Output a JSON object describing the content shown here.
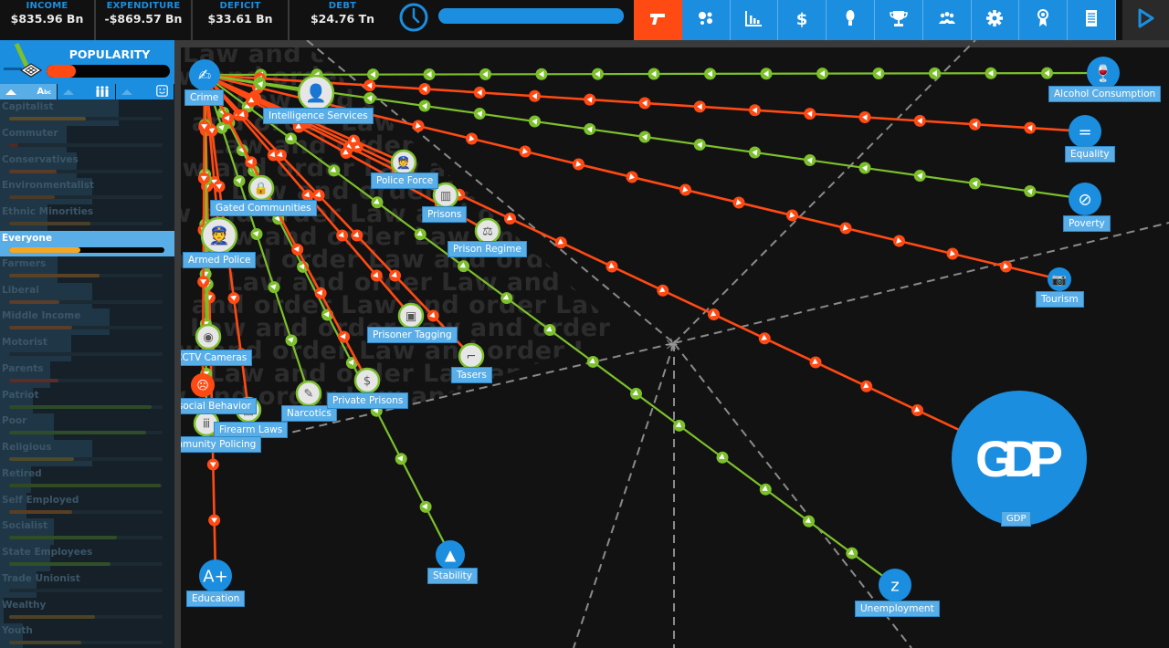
{
  "topbar": {
    "stats": [
      {
        "label": "INCOME",
        "value": "$835.96 Bn"
      },
      {
        "label": "EXPENDITURE",
        "value": "-$869.57 Bn"
      },
      {
        "label": "DEFICIT",
        "value": "$33.61 Bn"
      },
      {
        "label": "DEBT",
        "value": "$24.76 Tn"
      }
    ],
    "turn_progress": 1.0,
    "toolbar": [
      {
        "name": "law-and-order",
        "icon": "pistol-icon",
        "active": true
      },
      {
        "name": "public-services",
        "icon": "bubbles-icon",
        "active": false
      },
      {
        "name": "economy",
        "icon": "bar-chart-icon",
        "active": false
      },
      {
        "name": "tax",
        "icon": "dollar-icon",
        "active": false
      },
      {
        "name": "ideas",
        "icon": "lightbulb-icon",
        "active": false
      },
      {
        "name": "achievements",
        "icon": "trophy-icon",
        "active": false
      },
      {
        "name": "voters",
        "icon": "people-icon",
        "active": false
      },
      {
        "name": "settings",
        "icon": "gear-icon",
        "active": false
      },
      {
        "name": "ribbon",
        "icon": "award-ribbon-icon",
        "active": false
      },
      {
        "name": "report",
        "icon": "document-list-icon",
        "active": false
      }
    ],
    "next_turn_icon": "play-icon"
  },
  "sidebar": {
    "title": "POPULARITY",
    "overall_popularity": 0.24,
    "sort_buttons": [
      {
        "icon": "sort-alpha-icon",
        "label": "Aₐc"
      },
      {
        "icon": "sort-membership-icon"
      },
      {
        "icon": "sort-happiness-icon"
      }
    ],
    "groups": [
      {
        "name": "Capitalist",
        "membership": 0.68,
        "popularity": 0.5,
        "color": "#5a4a28"
      },
      {
        "name": "Commuter",
        "membership": 0.38,
        "popularity": 0.06,
        "color": "#4a2d24"
      },
      {
        "name": "Conservatives",
        "membership": 0.44,
        "popularity": 0.31,
        "color": "#5a3a28"
      },
      {
        "name": "Environmentalist",
        "membership": 0.53,
        "popularity": 0.3,
        "color": "#4a3a2a"
      },
      {
        "name": "Ethnic Minorities",
        "membership": 0.27,
        "popularity": 0.53,
        "color": "#4a3f2a"
      },
      {
        "name": "Everyone",
        "membership": 1.0,
        "popularity": 0.46,
        "color": "#f5a623",
        "selected": true
      },
      {
        "name": "Farmers",
        "membership": 0.33,
        "popularity": 0.59,
        "color": "#5a4226"
      },
      {
        "name": "Liberal",
        "membership": 0.53,
        "popularity": 0.33,
        "color": "#5a3d2a"
      },
      {
        "name": "Middle Income",
        "membership": 0.63,
        "popularity": 0.41,
        "color": "#5a3d2a"
      },
      {
        "name": "Motorist",
        "membership": 0.41,
        "popularity": 0.0,
        "color": "#3a3a2a"
      },
      {
        "name": "Parents",
        "membership": 0.29,
        "popularity": 0.32,
        "color": "#5a2d28"
      },
      {
        "name": "Patriot",
        "membership": 0.19,
        "popularity": 0.93,
        "color": "#2d4a28"
      },
      {
        "name": "Poor",
        "membership": 0.31,
        "popularity": 0.89,
        "color": "#2f4d2a"
      },
      {
        "name": "Religious",
        "membership": 0.53,
        "popularity": 0.42,
        "color": "#4d4a28"
      },
      {
        "name": "Retired",
        "membership": 0.18,
        "popularity": 0.99,
        "color": "#314a24"
      },
      {
        "name": "Self Employed",
        "membership": 0.15,
        "popularity": 0.41,
        "color": "#5a3e24"
      },
      {
        "name": "Socialist",
        "membership": 0.31,
        "popularity": 0.7,
        "color": "#2f4d26"
      },
      {
        "name": "State Employees",
        "membership": 0.29,
        "popularity": 0.66,
        "color": "#2f5028"
      },
      {
        "name": "Trade Unionist",
        "membership": 0.21,
        "popularity": 0.0,
        "color": "#2a3a2a"
      },
      {
        "name": "Wealthy",
        "membership": 0.02,
        "popularity": 0.56,
        "color": "#4d4224"
      },
      {
        "name": "Youth",
        "membership": 0.13,
        "popularity": 0.47,
        "color": "#4a4228"
      }
    ]
  },
  "map": {
    "watermark_text": "Law and order",
    "colors": {
      "positive": "#7cc02c",
      "negative": "#ff4a14",
      "node_blue": "#1b8ee0",
      "label_bg": "#5aaee8"
    },
    "hub": {
      "id": "crime",
      "label": "Crime",
      "icon": "crime-fingerprint-icon"
    },
    "policies": [
      {
        "id": "intel",
        "label": "Intelligence Services",
        "icon": "spy-icon"
      },
      {
        "id": "police",
        "label": "Police Force",
        "icon": "police-officer-icon"
      },
      {
        "id": "prisons",
        "label": "Prisons",
        "icon": "prison-door-icon"
      },
      {
        "id": "regime",
        "label": "Prison Regime",
        "icon": "scales-icon"
      },
      {
        "id": "gated",
        "label": "Gated Communities",
        "icon": "padlock-houses-icon"
      },
      {
        "id": "armed",
        "label": "Armed Police",
        "icon": "armed-officer-icon"
      },
      {
        "id": "cctv",
        "label": "CCTV Cameras",
        "icon": "cctv-camera-icon"
      },
      {
        "id": "tagging",
        "label": "Prisoner Tagging",
        "icon": "ankle-tag-icon"
      },
      {
        "id": "tasers",
        "label": "Tasers",
        "icon": "taser-icon"
      },
      {
        "id": "narcotics",
        "label": "Narcotics",
        "icon": "syringe-icon"
      },
      {
        "id": "private",
        "label": "Private Prisons",
        "icon": "money-prison-icon"
      },
      {
        "id": "firearm",
        "label": "Firearm Laws",
        "icon": "gun-license-icon"
      },
      {
        "id": "community",
        "label": "Community Policing",
        "icon": "community-people-icon"
      }
    ],
    "situations": [
      {
        "id": "antisocial",
        "label": "Antisocial Behavior",
        "icon": "vomiting-person-icon"
      }
    ],
    "outcomes": [
      {
        "id": "alcohol",
        "label": "Alcohol Consumption",
        "icon": "bottle-glass-icon"
      },
      {
        "id": "equality",
        "label": "Equality",
        "icon": "equality-people-icon"
      },
      {
        "id": "poverty",
        "label": "Poverty",
        "icon": "no-money-icon"
      },
      {
        "id": "tourism",
        "label": "Tourism",
        "icon": "camera-icon"
      },
      {
        "id": "gdp",
        "label": "GDP",
        "big_text": "GDP",
        "icon": "gdp-icon"
      },
      {
        "id": "unemployment",
        "label": "Unemployment",
        "icon": "sleeping-person-icon"
      },
      {
        "id": "stability",
        "label": "Stability",
        "icon": "balance-icon"
      },
      {
        "id": "education",
        "label": "Education",
        "icon": "report-card-icon"
      }
    ],
    "links": [
      {
        "from": "alcohol",
        "to": "crime",
        "effect": "positive"
      },
      {
        "from": "equality",
        "to": "crime",
        "effect": "negative"
      },
      {
        "from": "poverty",
        "to": "crime",
        "effect": "positive"
      },
      {
        "from": "crime",
        "to": "tourism",
        "effect": "negative"
      },
      {
        "from": "crime",
        "to": "gdp",
        "effect": "negative"
      },
      {
        "from": "crime",
        "to": "unemployment",
        "effect": "positive"
      },
      {
        "from": "crime",
        "to": "stability",
        "effect": "positive"
      },
      {
        "from": "crime",
        "to": "education",
        "effect": "negative"
      },
      {
        "from": "intel",
        "to": "crime",
        "effect": "positive"
      },
      {
        "from": "crime",
        "to": "police",
        "effect": "negative"
      },
      {
        "from": "crime",
        "to": "prisons",
        "effect": "negative"
      },
      {
        "from": "crime",
        "to": "regime",
        "effect": "negative"
      },
      {
        "from": "crime",
        "to": "gated",
        "effect": "positive"
      },
      {
        "from": "crime",
        "to": "armed",
        "effect": "negative"
      },
      {
        "from": "crime",
        "to": "cctv",
        "effect": "positive"
      },
      {
        "from": "crime",
        "to": "tagging",
        "effect": "negative"
      },
      {
        "from": "crime",
        "to": "tasers",
        "effect": "negative"
      },
      {
        "from": "crime",
        "to": "narcotics",
        "effect": "positive"
      },
      {
        "from": "crime",
        "to": "private",
        "effect": "negative"
      },
      {
        "from": "crime",
        "to": "firearm",
        "effect": "negative"
      },
      {
        "from": "crime",
        "to": "community",
        "effect": "positive"
      },
      {
        "from": "crime",
        "to": "antisocial",
        "effect": "negative"
      }
    ]
  }
}
